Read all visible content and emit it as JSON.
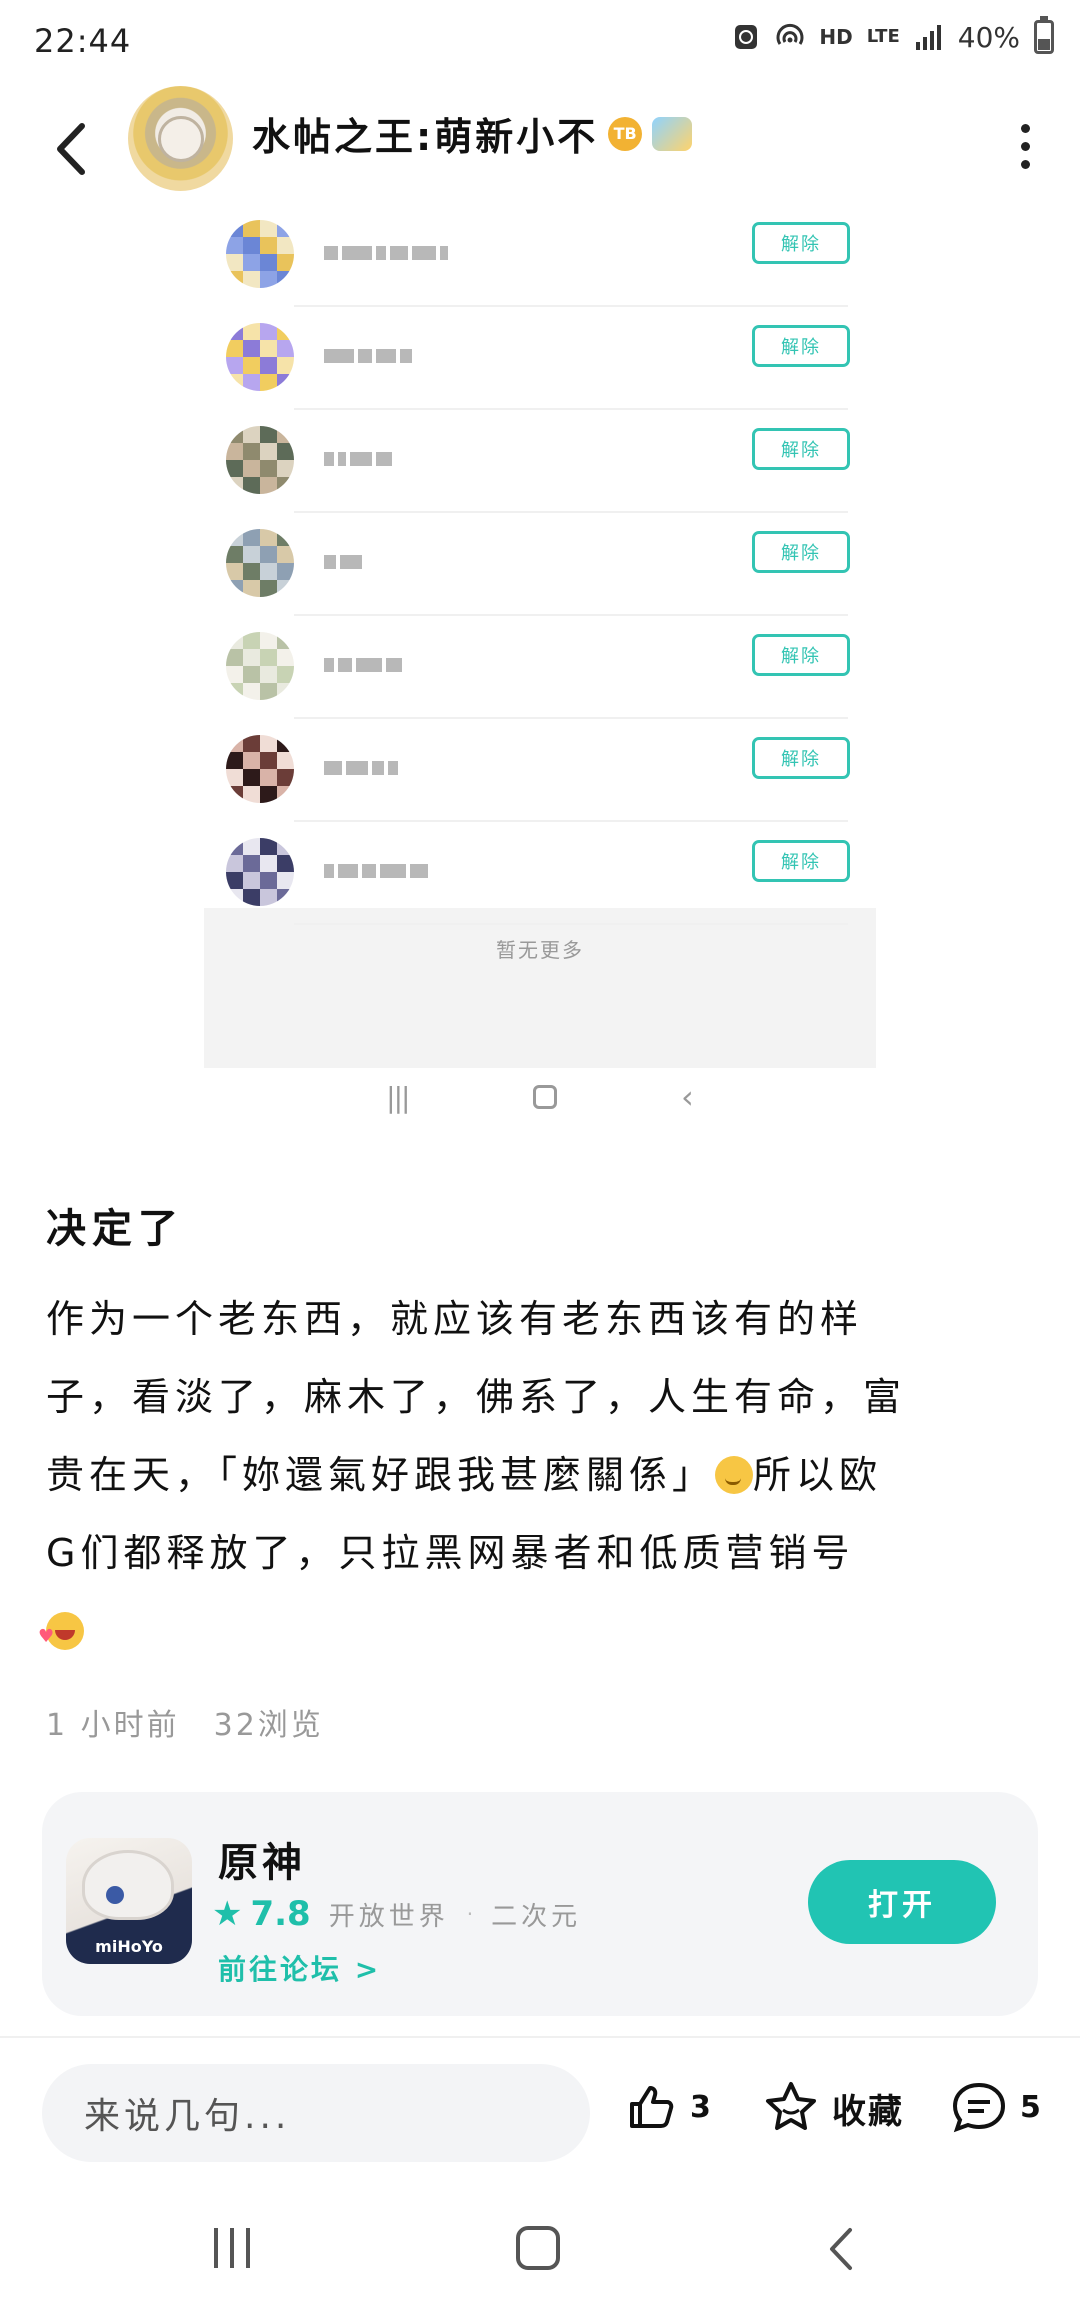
{
  "status_bar": {
    "time": "22:44",
    "hd": "HD",
    "lte": "LTE",
    "battery": "40%",
    "battery_level": 0.4
  },
  "header": {
    "title": "水帖之王:萌新小不",
    "badge_text": "TB"
  },
  "screenshot": {
    "unblock_label": "解除",
    "rows": 7,
    "footer_text": "暂无更多"
  },
  "post": {
    "title": "决定了",
    "body_line1": "作为一个老东西，就应该有老东西该有的样",
    "body_line2": "子，看淡了，麻木了，佛系了，人生有命，富",
    "body_line3a": "贵在天，「妳還氣好跟我甚麼關係」",
    "body_line3b": "所以欧",
    "body_line4": "G们都释放了，只拉黑网暴者和低质营销号",
    "time_ago": "1 小时前",
    "views": "32浏览"
  },
  "game_card": {
    "name": "原神",
    "rating": "7.8",
    "tag1": "开放世界",
    "tag_sep": "·",
    "tag2": "二次元",
    "forum_link": "前往论坛 >",
    "open_button": "打开",
    "icon_brand": "miHoYo"
  },
  "bottom_bar": {
    "comment_placeholder": "来说几句...",
    "like_count": "3",
    "favorite_label": "收藏",
    "comment_count": "5"
  },
  "colors": {
    "accent": "#21c4b3",
    "accent_text": "#1fbfaa",
    "muted": "#999999"
  }
}
